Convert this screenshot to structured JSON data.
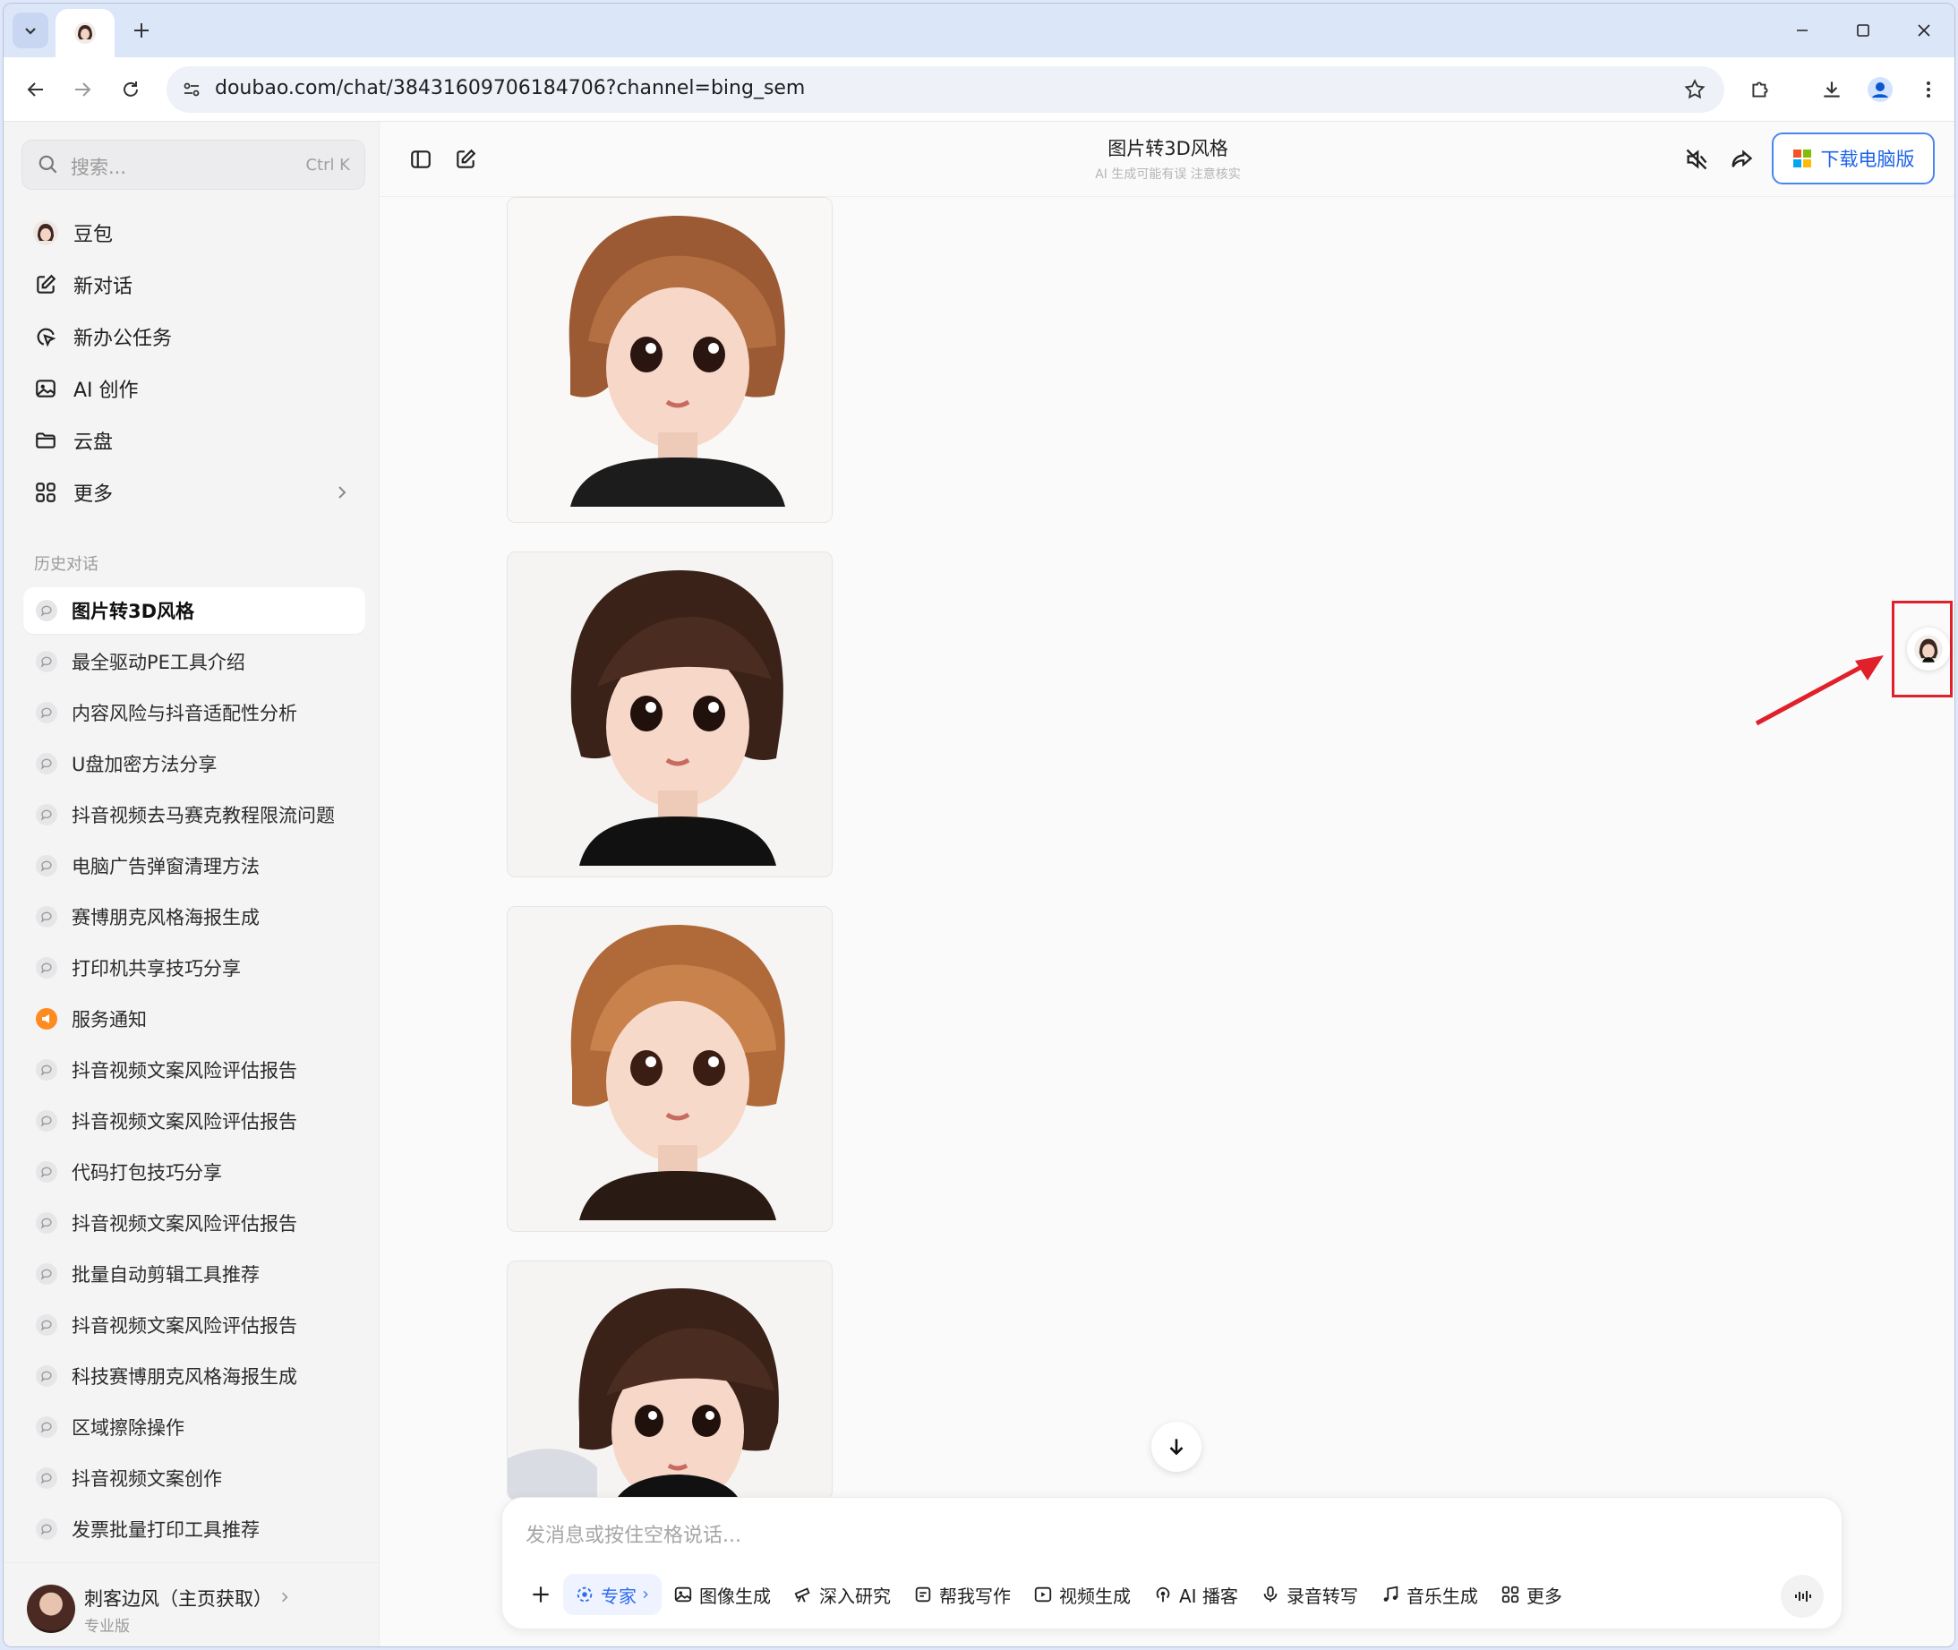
{
  "browser": {
    "url": "doubao.com/chat/38431609706184706?channel=bing_sem"
  },
  "sidebar": {
    "search_placeholder": "搜索...",
    "search_shortcut": "Ctrl K",
    "nav": [
      {
        "label": "豆包",
        "icon": "doubao-avatar-icon"
      },
      {
        "label": "新对话",
        "icon": "edit-icon"
      },
      {
        "label": "新办公任务",
        "icon": "cursor-task-icon"
      },
      {
        "label": "AI 创作",
        "icon": "image-icon"
      },
      {
        "label": "云盘",
        "icon": "folder-icon"
      },
      {
        "label": "更多",
        "icon": "grid-icon"
      }
    ],
    "history_title": "历史对话",
    "history": [
      "图片转3D风格",
      "最全驱动PE工具介绍",
      "内容风险与抖音适配性分析",
      "U盘加密方法分享",
      "抖音视频去马赛克教程限流问题",
      "电脑广告弹窗清理方法",
      "赛博朋克风格海报生成",
      "打印机共享技巧分享",
      "服务通知",
      "抖音视频文案风险评估报告",
      "抖音视频文案风险评估报告",
      "代码打包技巧分享",
      "抖音视频文案风险评估报告",
      "批量自动剪辑工具推荐",
      "抖音视频文案风险评估报告",
      "科技赛博朋克风格海报生成",
      "区域擦除操作",
      "抖音视频文案创作",
      "发票批量打印工具推荐"
    ],
    "user": {
      "name": "刺客边风（主页获取）",
      "plan": "专业版"
    }
  },
  "header": {
    "title": "图片转3D风格",
    "subtitle": "AI 生成可能有误 注意核实",
    "download_label": "下载电脑版"
  },
  "composer": {
    "placeholder": "发消息或按住空格说话...",
    "tools": [
      "专家",
      "图像生成",
      "深入研究",
      "帮我写作",
      "视频生成",
      "AI 播客",
      "录音转写",
      "音乐生成",
      "更多"
    ]
  },
  "colors": {
    "accent": "#1d64e8",
    "annotation_red": "#e0202a",
    "notice_orange": "#ff8a1f"
  }
}
